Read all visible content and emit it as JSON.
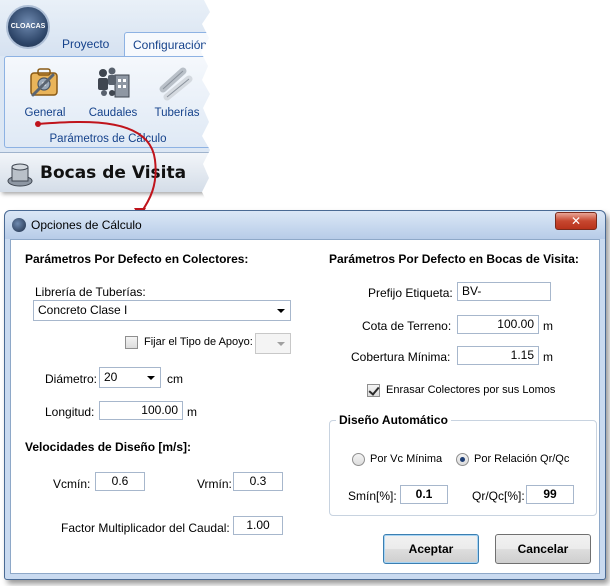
{
  "ribbon": {
    "logo_text": "CLOACAS",
    "tabs": [
      "Proyecto",
      "Configuración"
    ],
    "buttons": [
      {
        "label": "General"
      },
      {
        "label": "Caudales"
      },
      {
        "label": "Tuberías"
      }
    ],
    "group_label": "Parámetros de Cálculo",
    "bocas_label": "Bocas de Visita"
  },
  "dialog": {
    "title": "Opciones de Cálculo",
    "close_glyph": "✕",
    "colectores": {
      "header": "Parámetros Por Defecto en Colectores:",
      "libreria_label": "Librería de Tuberías:",
      "libreria_value": "Concreto Clase I",
      "fijar_label": "Fijar el Tipo de Apoyo:",
      "fijar_checked": false,
      "diametro_label": "Diámetro:",
      "diametro_value": "20",
      "diametro_unit": "cm",
      "longitud_label": "Longitud:",
      "longitud_value": "100.00",
      "longitud_unit": "m"
    },
    "velocidades": {
      "header": "Velocidades de Diseño [m/s]:",
      "vcmin_label": "Vcmín:",
      "vcmin_value": "0.6",
      "vrmin_label": "Vrmín:",
      "vrmin_value": "0.3",
      "factor_label": "Factor Multiplicador del Caudal:",
      "factor_value": "1.00"
    },
    "bocas": {
      "header": "Parámetros Por Defecto en Bocas de Visita:",
      "prefijo_label": "Prefijo Etiqueta:",
      "prefijo_value": "BV-",
      "cota_label": "Cota de Terreno:",
      "cota_value": "100.00",
      "cota_unit": "m",
      "cobertura_label": "Cobertura Mínima:",
      "cobertura_value": "1.15",
      "cobertura_unit": "m",
      "enrasar_label": "Enrasar Colectores por sus Lomos",
      "enrasar_checked": true
    },
    "diseno": {
      "title": "Diseño Automático",
      "radio_vc_label": "Por Vc Mínima",
      "radio_rel_label": "Por Relación Qr/Qc",
      "selected": "Por Relación Qr/Qc",
      "smin_label": "Smín[%]:",
      "smin_value": "0.1",
      "qrqc_label": "Qr/Qc[%]:",
      "qrqc_value": "99"
    },
    "aceptar_label": "Aceptar",
    "cancelar_label": "Cancelar"
  },
  "colors": {
    "ribbon_text": "#15428b",
    "arrow": "#c0141c",
    "dialog_frame": "#c9daf0"
  }
}
